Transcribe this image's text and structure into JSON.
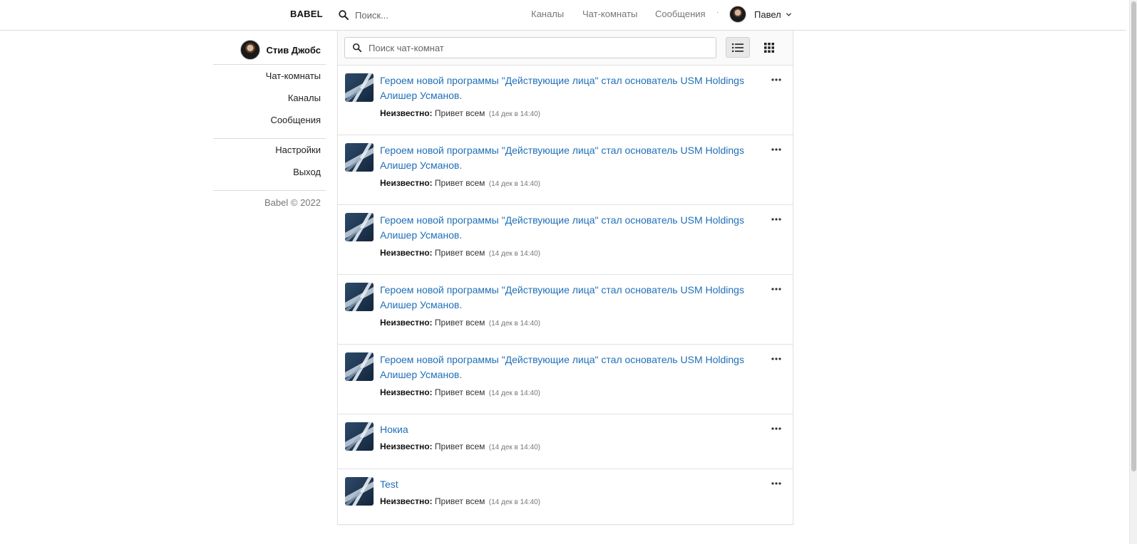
{
  "header": {
    "brand": "BABEL",
    "search_placeholder": "Поиск...",
    "nav": [
      {
        "label": "Каналы"
      },
      {
        "label": "Чат-комнаты"
      },
      {
        "label": "Сообщения"
      }
    ],
    "separator": "·",
    "user_name": "Павел"
  },
  "sidebar": {
    "profile_name": "Стив Джобс",
    "group1": [
      {
        "label": "Чат-комнаты"
      },
      {
        "label": "Каналы"
      },
      {
        "label": "Сообщения"
      }
    ],
    "group2": [
      {
        "label": "Настройки"
      },
      {
        "label": "Выход"
      }
    ],
    "copyright": "Babel © 2022"
  },
  "main": {
    "search_placeholder": "Поиск чат-комнат",
    "view_list_icon": "list-view-icon",
    "view_grid_icon": "grid-view-icon",
    "rooms": [
      {
        "title": "Героем новой программы \"Действующие лица\" стал основатель USM Holdings Алишер Усманов.",
        "author": "Неизвестно:",
        "message": "Привет всем",
        "time": "(14 дек в 14:40)"
      },
      {
        "title": "Героем новой программы \"Действующие лица\" стал основатель USM Holdings Алишер Усманов.",
        "author": "Неизвестно:",
        "message": "Привет всем",
        "time": "(14 дек в 14:40)"
      },
      {
        "title": "Героем новой программы \"Действующие лица\" стал основатель USM Holdings Алишер Усманов.",
        "author": "Неизвестно:",
        "message": "Привет всем",
        "time": "(14 дек в 14:40)"
      },
      {
        "title": "Героем новой программы \"Действующие лица\" стал основатель USM Holdings Алишер Усманов.",
        "author": "Неизвестно:",
        "message": "Привет всем",
        "time": "(14 дек в 14:40)"
      },
      {
        "title": "Героем новой программы \"Действующие лица\" стал основатель USM Holdings Алишер Усманов.",
        "author": "Неизвестно:",
        "message": "Привет всем",
        "time": "(14 дек в 14:40)"
      },
      {
        "title": "Нокиа",
        "author": "Неизвестно:",
        "message": "Привет всем",
        "time": "(14 дек в 14:40)"
      },
      {
        "title": "Test",
        "author": "Неизвестно:",
        "message": "Привет всем",
        "time": "(14 дек в 14:40)"
      }
    ]
  },
  "colors": {
    "link": "#1f6fb8",
    "muted": "#777777",
    "border": "#e2e2e2"
  }
}
